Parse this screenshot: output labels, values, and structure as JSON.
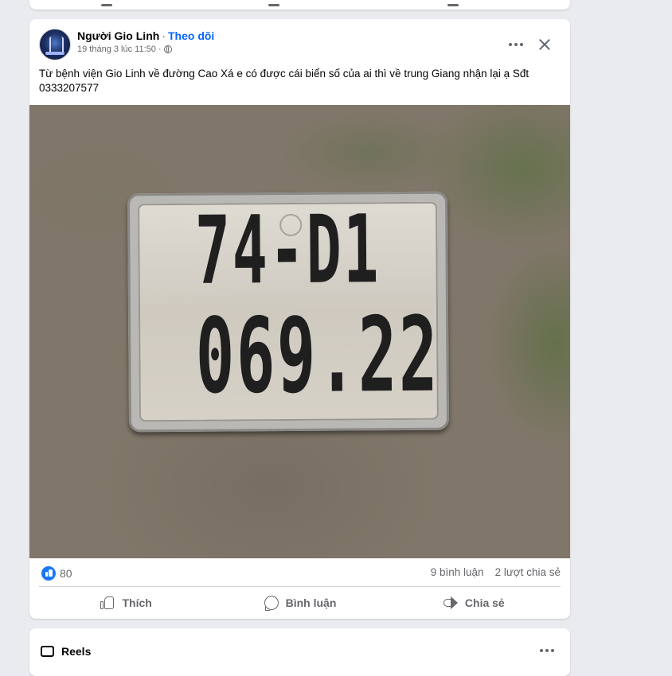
{
  "post": {
    "author": "Người Gio Linh",
    "separator": "·",
    "follow_label": "Theo dõi",
    "timestamp": "19 tháng 3 lúc 11:50",
    "meta_separator": "·",
    "privacy_icon": "globe-icon",
    "text": "Từ bệnh viện Gio Linh về đường Cao Xá e có được cái biển số của ai thì về trung Giang nhận lại ạ Sđt 0333207577",
    "photo": {
      "plate_line1": "74-D1",
      "plate_line2": "069.22"
    },
    "reactions": {
      "count": "80",
      "comments": "9 bình luận",
      "shares": "2 lượt chia sẻ"
    },
    "actions": {
      "like": "Thích",
      "comment": "Bình luận",
      "share": "Chia sẻ"
    }
  },
  "next_section": {
    "title": "Reels"
  },
  "colors": {
    "accent": "#0866ff",
    "like_badge": "#1877f2",
    "muted_text": "#65676b",
    "background": "#e9ebee"
  }
}
